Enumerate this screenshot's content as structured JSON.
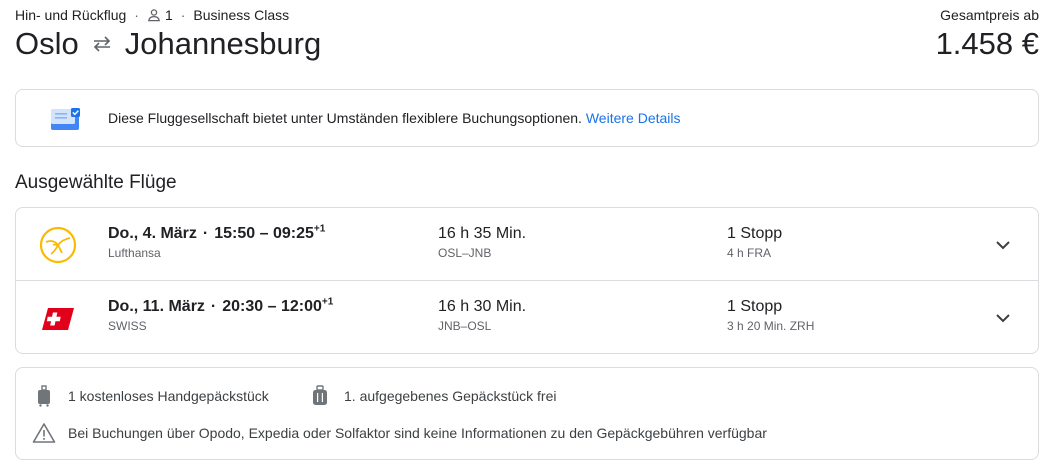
{
  "header": {
    "trip_type": "Hin- und Rückflug",
    "passengers": "1",
    "cabin_class": "Business Class",
    "origin": "Oslo",
    "destination": "Johannesburg",
    "price_label": "Gesamtpreis ab",
    "price": "1.458 €"
  },
  "notice": {
    "text": "Diese Fluggesellschaft bietet unter Umständen flexiblere Buchungsoptionen.",
    "link_label": "Weitere Details"
  },
  "section_title": "Ausgewählte Flüge",
  "flights": [
    {
      "date": "Do., 4. März",
      "departure": "15:50",
      "arrival": "09:25",
      "day_offset": "+1",
      "airline": "Lufthansa",
      "duration": "16 h 35 Min.",
      "route": "OSL–JNB",
      "stops": "1 Stopp",
      "layover": "4 h FRA",
      "logo": "lufthansa-crane-icon"
    },
    {
      "date": "Do., 11. März",
      "departure": "20:30",
      "arrival": "12:00",
      "day_offset": "+1",
      "airline": "SWISS",
      "duration": "16 h 30 Min.",
      "route": "JNB–OSL",
      "stops": "1 Stopp",
      "layover": "3 h 20 Min. ZRH",
      "logo": "swiss-flag-icon"
    }
  ],
  "baggage": {
    "carry_on": "1 kostenloses Handgepäckstück",
    "checked": "1. aufgegebenes Gepäckstück frei",
    "info": "Bei Buchungen über Opodo, Expedia oder Solfaktor sind keine Informationen zu den Gepäckgebühren verfügbar"
  },
  "colors": {
    "link": "#1a73e8",
    "border": "#dadce0",
    "secondary_text": "#5f6368",
    "lufthansa_yellow": "#f9ba00",
    "swiss_red": "#e2001a"
  }
}
